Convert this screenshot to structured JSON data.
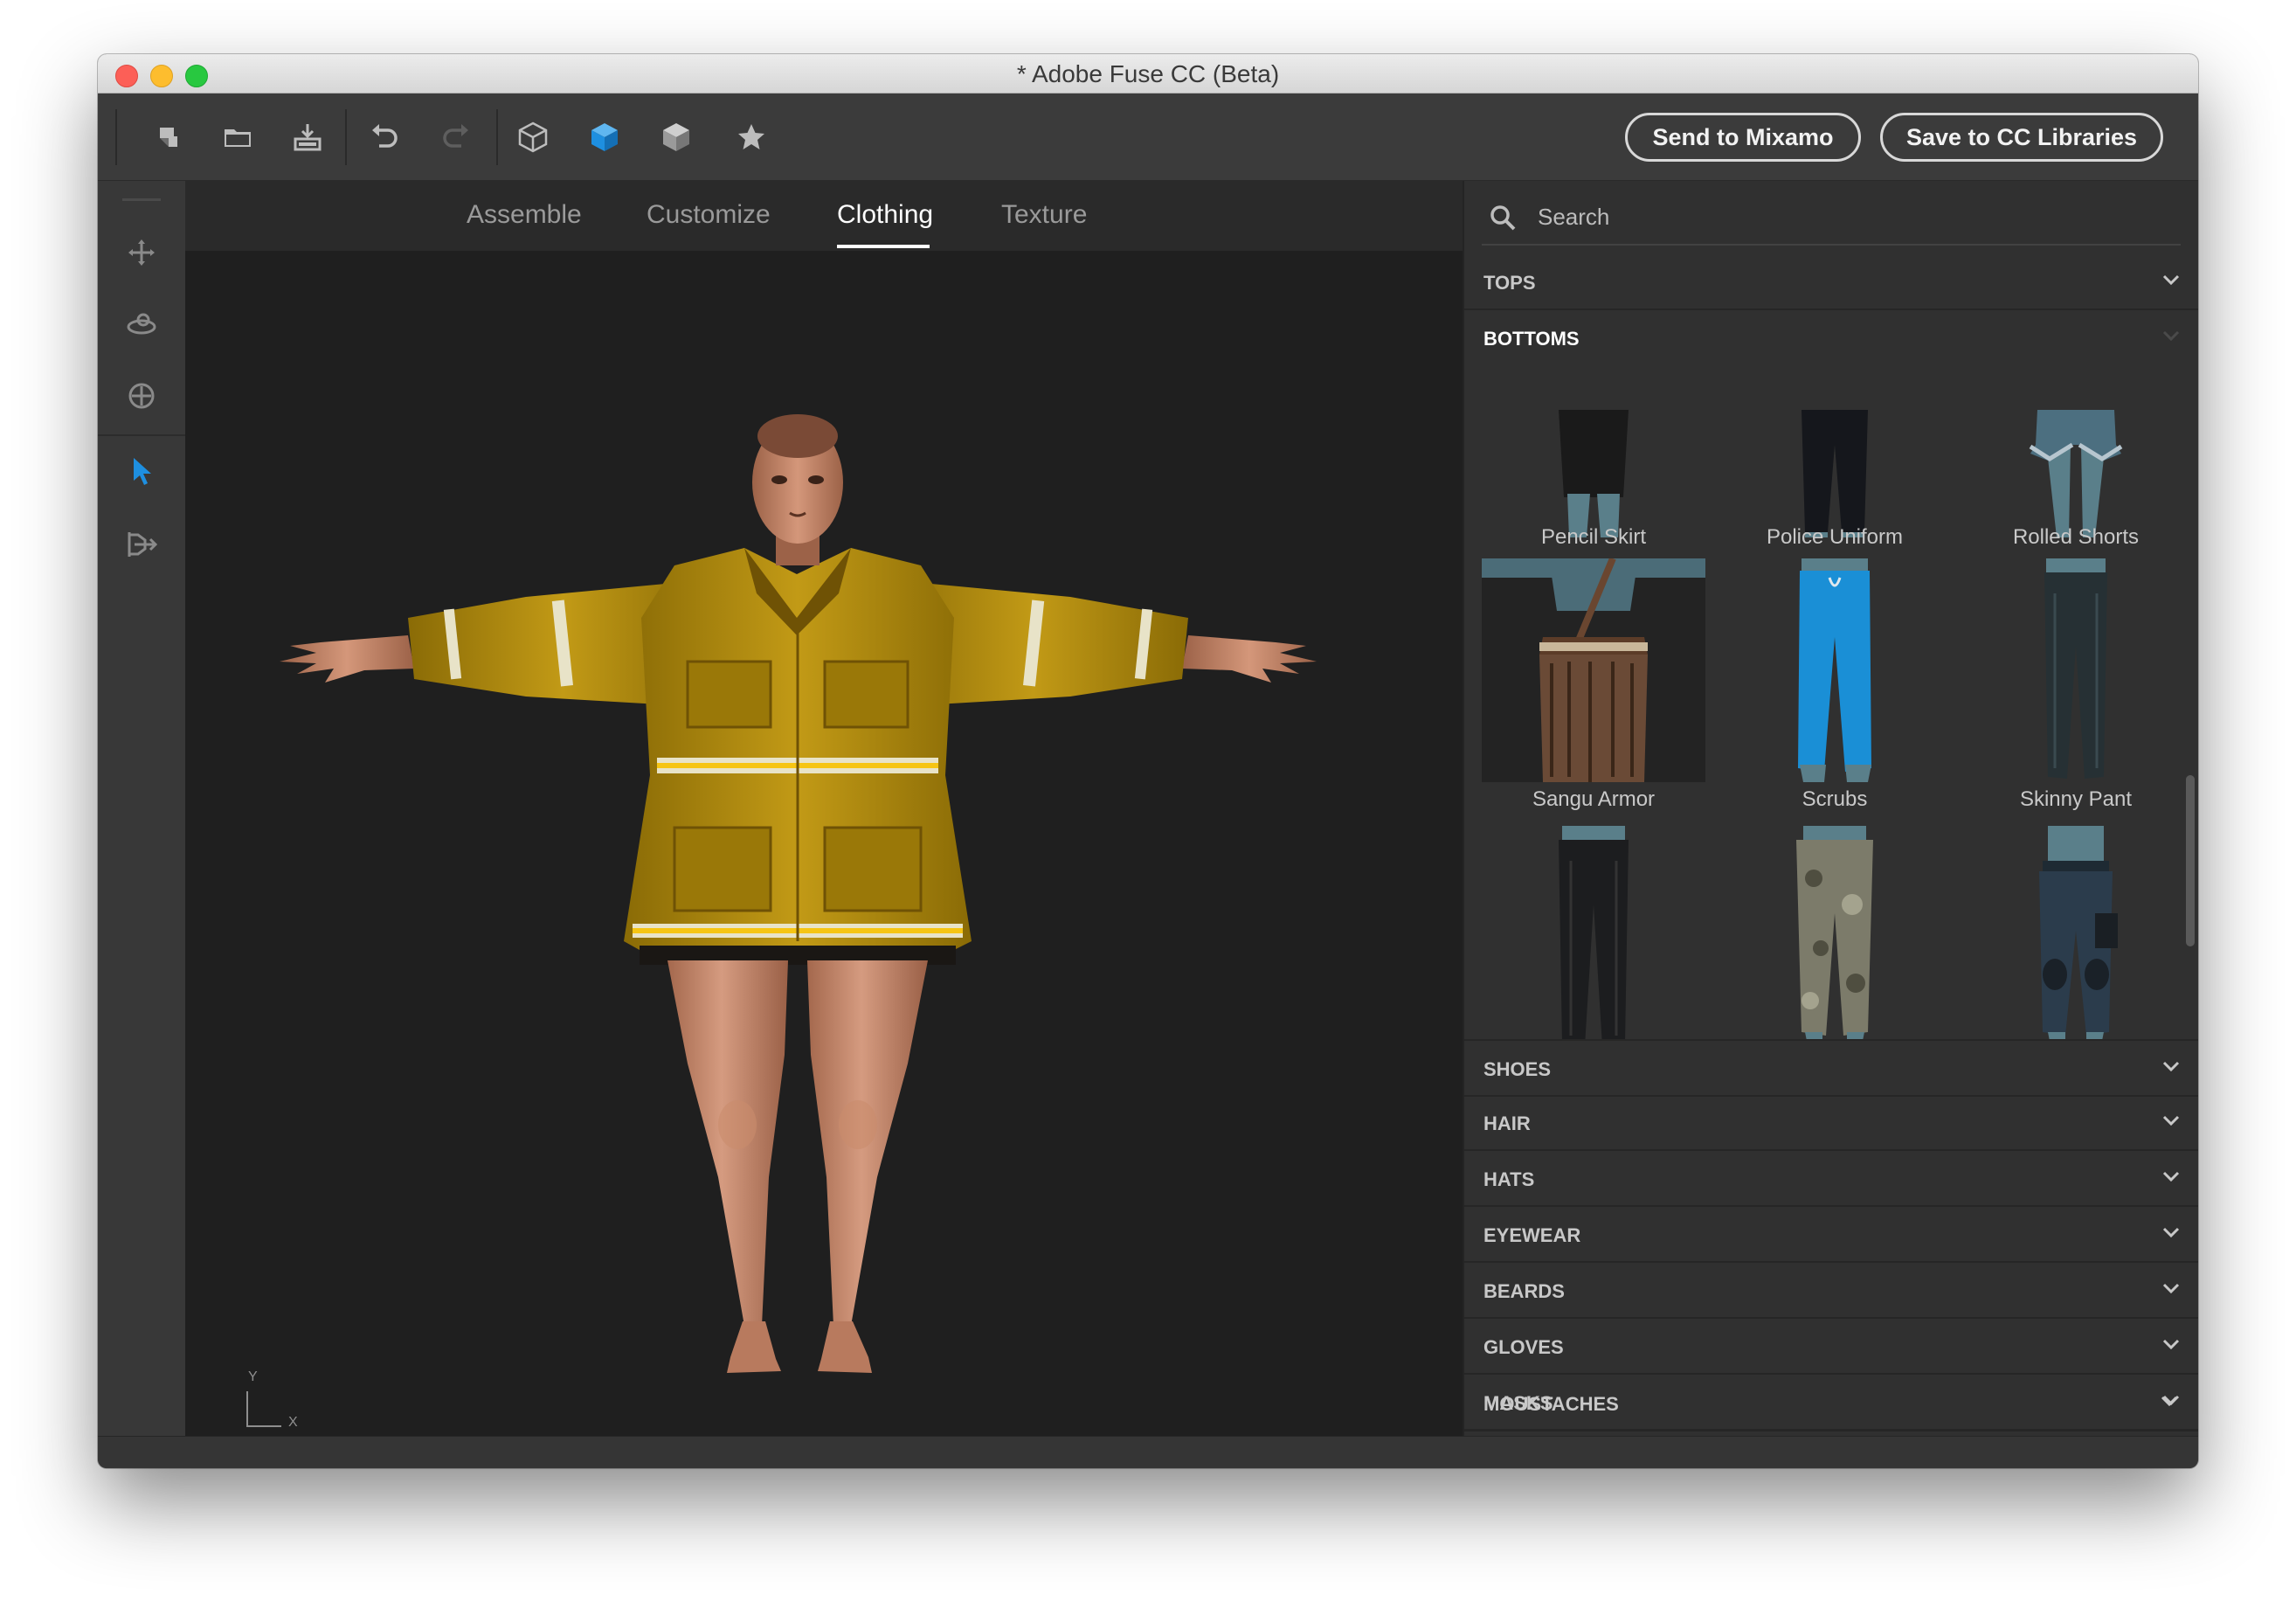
{
  "window": {
    "title": "* Adobe Fuse CC (Beta)"
  },
  "toolbar": {
    "icons": [
      "new-file-icon",
      "open-folder-icon",
      "import-icon",
      "undo-icon",
      "redo-icon",
      "cube-outline-icon",
      "cube-solid-icon",
      "cube-shaded-icon",
      "star-icon"
    ],
    "send_mixamo_label": "Send to Mixamo",
    "save_cc_label": "Save to CC Libraries"
  },
  "left_tools": [
    "move-icon",
    "rotate-icon",
    "target-icon",
    "select-arrow-icon",
    "export-icon"
  ],
  "tabs": [
    {
      "label": "Assemble",
      "active": false
    },
    {
      "label": "Customize",
      "active": false
    },
    {
      "label": "Clothing",
      "active": true
    },
    {
      "label": "Texture",
      "active": false
    }
  ],
  "viewport": {
    "axis_y": "Y",
    "axis_x": "X"
  },
  "panel": {
    "search_placeholder": "Search",
    "categories_top": [
      {
        "label": "TOPS",
        "expanded": false
      },
      {
        "label": "BOTTOMS",
        "expanded": true
      }
    ],
    "bottoms_items": [
      {
        "label": "Pencil Skirt"
      },
      {
        "label": "Police Uniform"
      },
      {
        "label": "Rolled Shorts"
      },
      {
        "label": "Sangu Armor"
      },
      {
        "label": "Scrubs"
      },
      {
        "label": "Skinny Pant"
      },
      {
        "label": ""
      },
      {
        "label": ""
      },
      {
        "label": ""
      }
    ],
    "categories_bottom": [
      {
        "label": "SHOES"
      },
      {
        "label": "HAIR"
      },
      {
        "label": "HATS"
      },
      {
        "label": "EYEWEAR"
      },
      {
        "label": "BEARDS"
      },
      {
        "label": "GLOVES"
      },
      {
        "label": "MASKS"
      },
      {
        "label": "MOUSTACHES"
      }
    ]
  },
  "colors": {
    "accent_blue": "#1e8fe0",
    "jacket_yellow": "#b8900a",
    "skin": "#c98c6c"
  }
}
